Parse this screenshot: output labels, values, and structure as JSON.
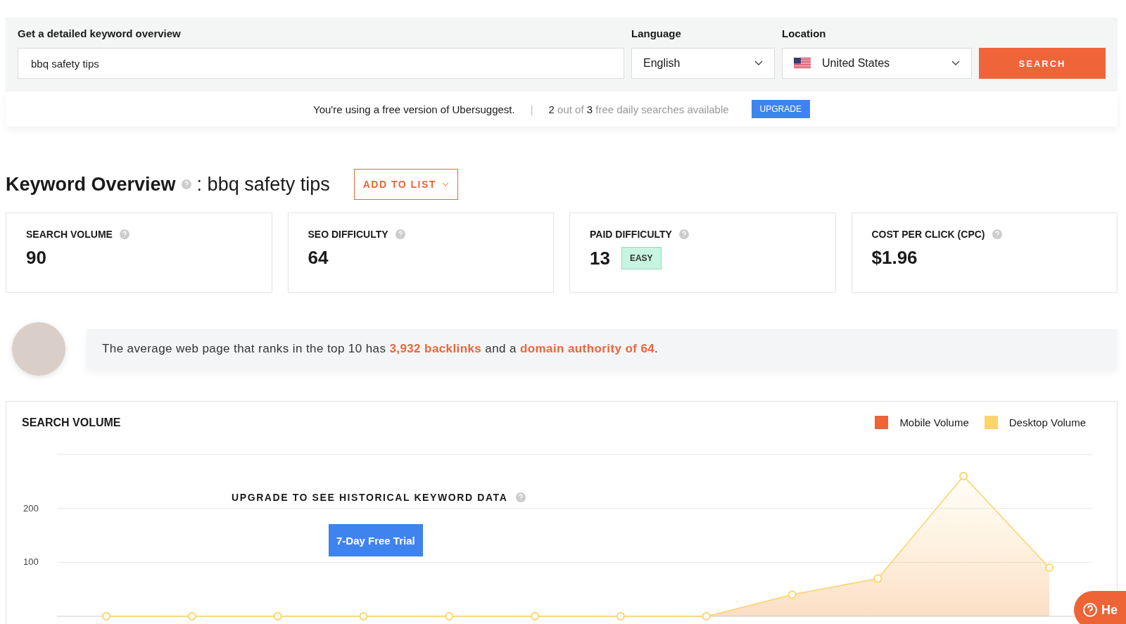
{
  "search_form": {
    "keyword_label": "Get a detailed keyword overview",
    "keyword_value": "bbq safety tips",
    "language_label": "Language",
    "language_value": "English",
    "location_label": "Location",
    "location_value": "United States",
    "search_button": "SEARCH"
  },
  "notice": {
    "text": "You're using a free version of Ubersuggest.",
    "separator": "|",
    "quota": "**2** out of **3** free daily searches available",
    "upgrade_button": "UPGRADE"
  },
  "overview": {
    "title": "Keyword Overview",
    "keyword": ": bbq safety tips",
    "add_button": "ADD TO LIST"
  },
  "metrics": [
    {
      "label": "SEARCH VOLUME",
      "value": "90"
    },
    {
      "label": "SEO DIFFICULTY",
      "value": "64"
    },
    {
      "label": "PAID DIFFICULTY",
      "value": "13",
      "badge": "EASY"
    },
    {
      "label": "COST PER CLICK (CPC)",
      "value": "$1.96"
    }
  ],
  "tip": {
    "before": "The average web page that ranks in the top 10 has ",
    "link_1": "3,932 backlinks",
    "middle": " and a ",
    "link_2": "domain authority of 64",
    "after": "."
  },
  "search_volume": {
    "title": "SEARCH VOLUME",
    "upgrade_text": "UPGRADE TO SEE HISTORICAL KEYWORD DATA",
    "trial_button": "7-Day Free Trial",
    "chart_data": {
      "type": "area",
      "ylim": [
        0,
        300
      ],
      "yticks": [
        100,
        200
      ],
      "series": [
        {
          "name": "Mobile Volume",
          "color": "#ee6436",
          "values": [
            null,
            null,
            null,
            null,
            null,
            null,
            null,
            null,
            null,
            null,
            null,
            null
          ]
        },
        {
          "name": "Desktop Volume",
          "color": "#fdd36b",
          "values": [
            0,
            0,
            0,
            0,
            0,
            0,
            0,
            0,
            40,
            70,
            260,
            90
          ]
        }
      ]
    }
  },
  "help_button": "He"
}
